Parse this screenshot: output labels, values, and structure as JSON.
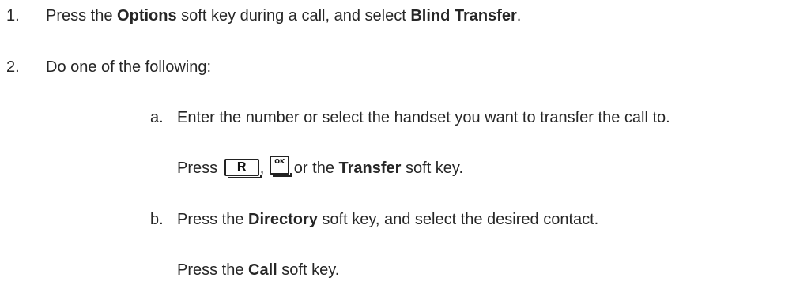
{
  "steps": [
    {
      "number": "1.",
      "parts": [
        "Press the ",
        "Options",
        " soft key during a call, and select ",
        "Blind Transfer",
        "."
      ]
    },
    {
      "number": "2.",
      "text": "Do one of the following:"
    }
  ],
  "substeps": [
    {
      "letter": "a.",
      "text": "Enter the number or select the handset you want to transfer the call to.",
      "followup": {
        "prefix": "Press ",
        "key_r": "R",
        "sep": ",",
        "key_ok": "OK",
        "middle": " or the ",
        "bold": "Transfer",
        "suffix": " soft key."
      }
    },
    {
      "letter": "b.",
      "parts": [
        "Press the ",
        "Directory",
        " soft key, and select the desired contact."
      ],
      "followup": {
        "prefix": "Press the ",
        "bold": "Call",
        "suffix": " soft key."
      }
    }
  ]
}
